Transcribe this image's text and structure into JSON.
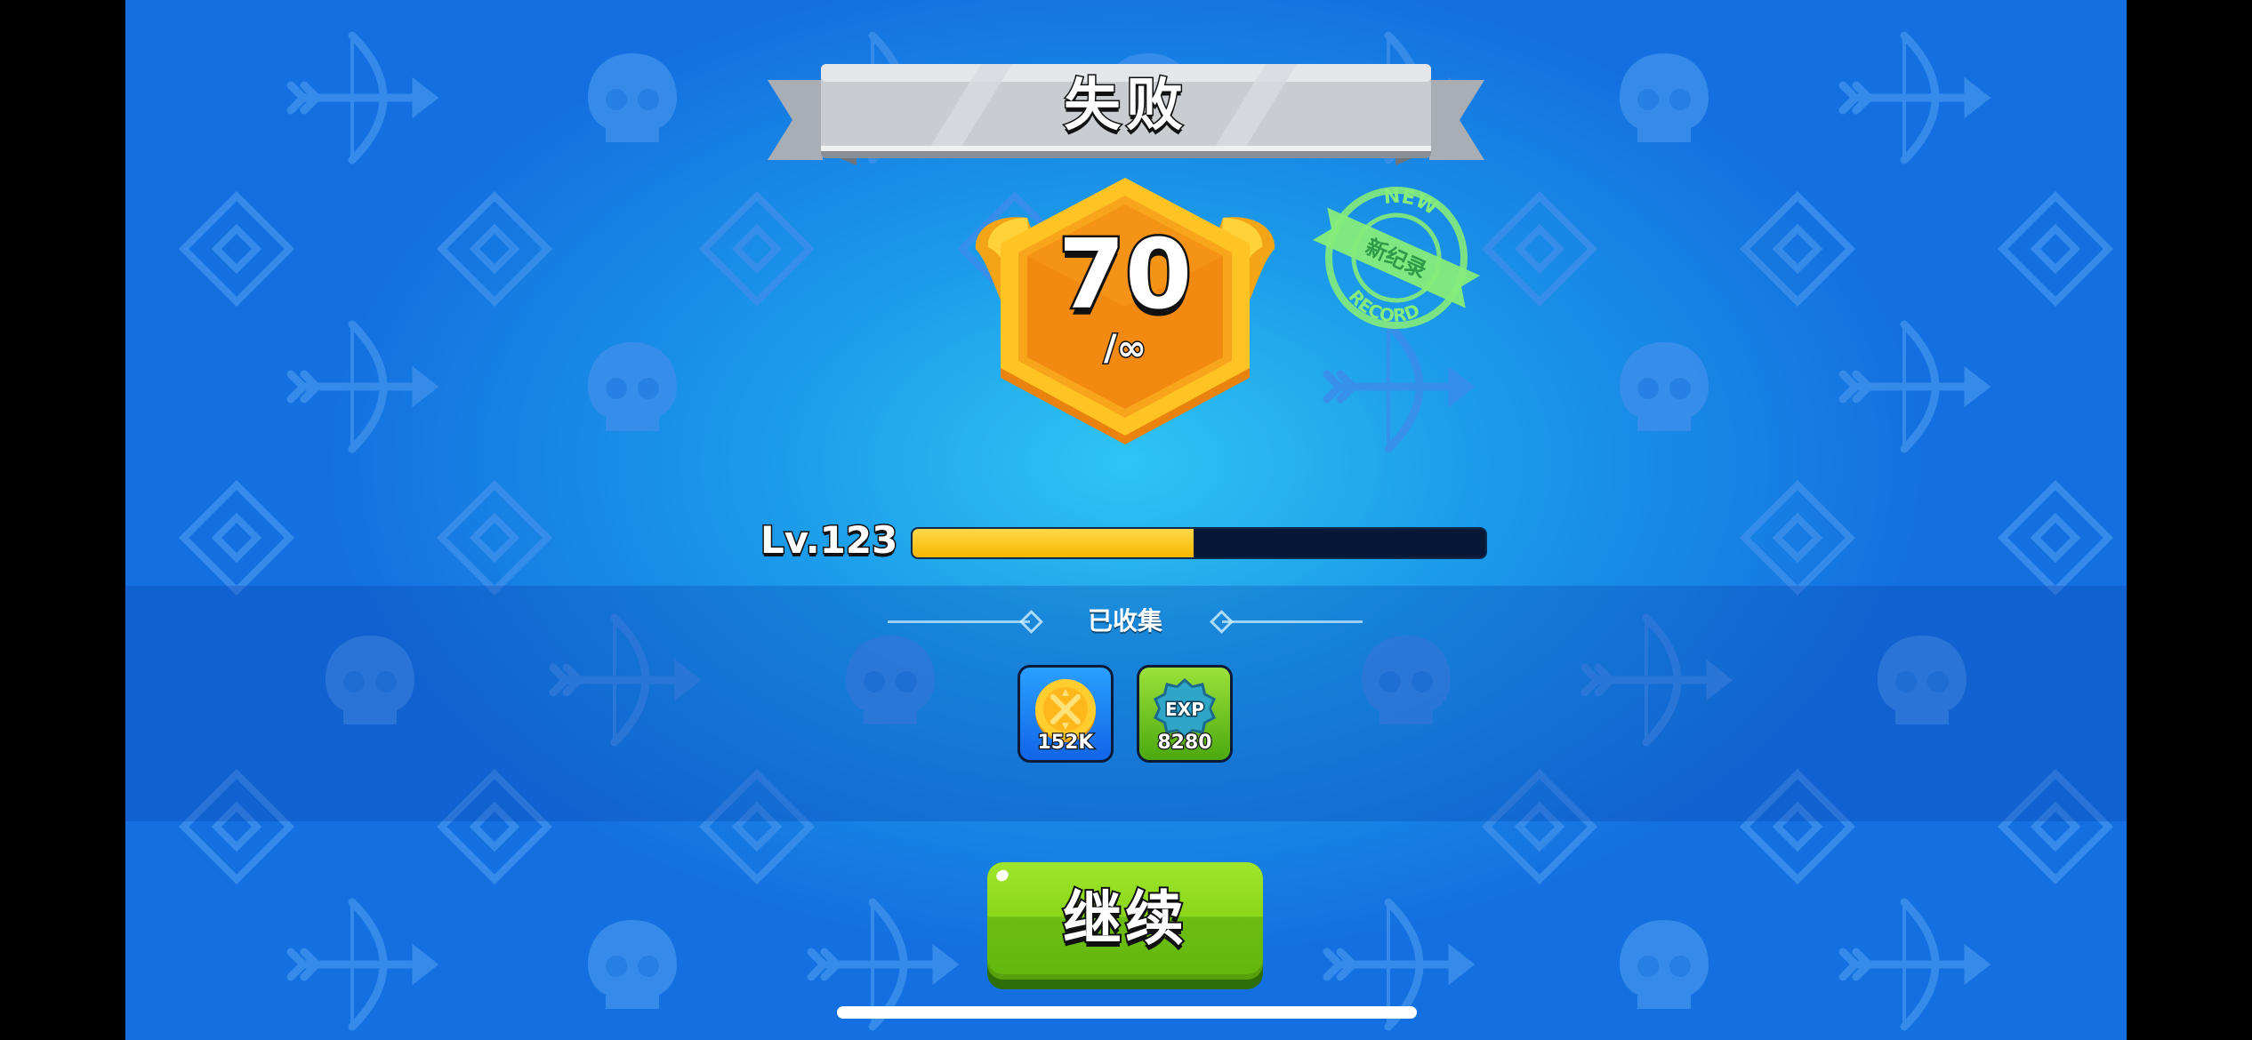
{
  "result": {
    "title": "失败"
  },
  "score": {
    "value": "70",
    "limit": "/∞"
  },
  "record_stamp": {
    "top_text": "NEW",
    "middle_text": "新纪录",
    "bottom_text": "RECORD"
  },
  "level": {
    "label": "Lv.123",
    "progress": 0.49
  },
  "collected": {
    "title": "已收集",
    "items": [
      {
        "icon": "gold-coin-icon",
        "value": "152K"
      },
      {
        "icon": "exp-badge-icon",
        "value": "8280"
      }
    ]
  },
  "continue_button": {
    "label": "继续"
  },
  "colors": {
    "background": "#1b9bea",
    "progress_fill": "#f7b800",
    "button_green": "#8bd61a",
    "stamp_green": "#7be36f"
  }
}
